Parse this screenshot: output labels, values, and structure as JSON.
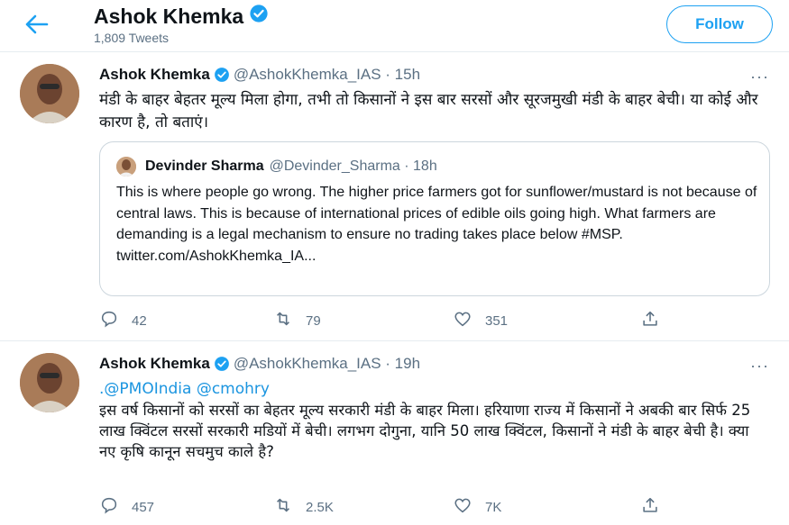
{
  "header": {
    "name": "Ashok Khemka",
    "tweet_count": "1,809 Tweets",
    "follow_label": "Follow"
  },
  "colors": {
    "accent": "#1da1f2",
    "link": "#1b95e0",
    "muted": "#5b7083"
  },
  "tweets": [
    {
      "name": "Ashok Khemka",
      "handle_time": "@AshokKhemka_IAS · 15h",
      "more": "···",
      "text": "मंडी के बाहर बेहतर मूल्य मिला होगा, तभी तो किसानों ने इस बार सरसों और सूरजमुखी मंडी के बाहर बेची। या कोई और कारण है, तो बताएं।",
      "quote": {
        "name": "Devinder Sharma",
        "handle_time": "@Devinder_Sharma · 18h",
        "text": "This is where people go wrong. The higher price farmers got for sunflower/mustard is not because of central laws. This is because of international prices of edible oils going high. What farmers are demanding is a legal mechanism to ensure no trading takes place below #MSP. twitter.com/AshokKhemka_IA..."
      },
      "replies": "42",
      "retweets": "79",
      "likes": "351"
    },
    {
      "name": "Ashok Khemka",
      "handle_time": "@AshokKhemka_IAS · 19h",
      "more": "···",
      "mentions": ".@PMOIndia @cmohry",
      "text": "इस वर्ष किसानों को सरसों का बेहतर मूल्य सरकारी मंडी के बाहर मिला। हरियाणा राज्य में किसानों ने अबकी बार सिर्फ 25 लाख क्विंटल सरसों सरकारी मडियों में बेची। लगभग दोगुना, यानि 50 लाख क्विंटल, किसानों ने मंडी के बाहर बेची है। क्या नए कृषि कानून सचमुच काले है?",
      "replies": "457",
      "retweets": "2.5K",
      "likes": "7K"
    }
  ]
}
